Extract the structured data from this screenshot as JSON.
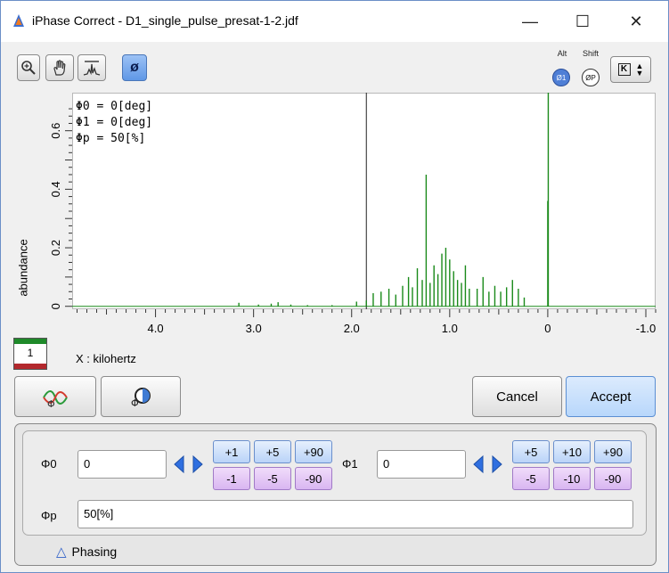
{
  "window": {
    "title": "iPhase Correct - D1_single_pulse_presat-1-2.jdf",
    "minimize_glyph": "—",
    "maximize_glyph": "☐",
    "close_glyph": "✕"
  },
  "toolbar": {
    "tools": [
      {
        "name": "zoom-icon"
      },
      {
        "name": "pan-hand-icon"
      },
      {
        "name": "peak-icon"
      },
      {
        "name": "phase-icon",
        "label": "ø",
        "active": true
      }
    ],
    "modifiers": [
      {
        "key": "Alt",
        "label": "Ø1"
      },
      {
        "key": "Shift",
        "label": "ØP"
      }
    ],
    "k_button_label": "K"
  },
  "plot": {
    "readout": [
      "Φ0 = 0[deg]",
      "Φ1 = 0[deg]",
      "Φp = 50[%]"
    ],
    "y_axis_label": "abundance",
    "x_axis_label": "X : kilohertz",
    "page_number": "1",
    "colors": {
      "spectrum": "#1a8a1a",
      "pivot_line": "#222222",
      "frame": "#b8b8b8"
    }
  },
  "chart_data": {
    "type": "line",
    "ylabel": "abundance",
    "xlabel": "X : kilohertz",
    "xlim": [
      4.85,
      -1.1
    ],
    "ylim": [
      -0.01,
      0.73
    ],
    "x_reversed": true,
    "x_ticks": [
      "4.0",
      "3.0",
      "2.0",
      "1.0",
      "0",
      "-1.0"
    ],
    "x_tick_values": [
      4.0,
      3.0,
      2.0,
      1.0,
      0.0,
      -1.0
    ],
    "y_ticks": [
      "0",
      "0.2",
      "0.4",
      "0.6"
    ],
    "y_tick_values": [
      0.0,
      0.2,
      0.4,
      0.6
    ],
    "pivot_x": 1.85,
    "series": [
      {
        "peaks": [
          [
            3.15,
            0.012
          ],
          [
            2.95,
            0.006
          ],
          [
            2.82,
            0.009
          ],
          [
            2.75,
            0.014
          ],
          [
            2.62,
            0.006
          ],
          [
            2.45,
            0.004
          ],
          [
            2.2,
            0.004
          ],
          [
            1.95,
            0.016
          ],
          [
            1.85,
            0.02
          ],
          [
            1.78,
            0.045
          ],
          [
            1.7,
            0.05
          ],
          [
            1.62,
            0.06
          ],
          [
            1.55,
            0.04
          ],
          [
            1.48,
            0.07
          ],
          [
            1.42,
            0.1
          ],
          [
            1.38,
            0.065
          ],
          [
            1.33,
            0.13
          ],
          [
            1.28,
            0.09
          ],
          [
            1.24,
            0.45
          ],
          [
            1.2,
            0.08
          ],
          [
            1.16,
            0.14
          ],
          [
            1.12,
            0.11
          ],
          [
            1.08,
            0.18
          ],
          [
            1.04,
            0.2
          ],
          [
            1.0,
            0.16
          ],
          [
            0.96,
            0.12
          ],
          [
            0.92,
            0.09
          ],
          [
            0.88,
            0.08
          ],
          [
            0.84,
            0.14
          ],
          [
            0.8,
            0.06
          ],
          [
            0.72,
            0.06
          ],
          [
            0.66,
            0.1
          ],
          [
            0.6,
            0.05
          ],
          [
            0.54,
            0.07
          ],
          [
            0.48,
            0.05
          ],
          [
            0.42,
            0.065
          ],
          [
            0.36,
            0.09
          ],
          [
            0.3,
            0.06
          ],
          [
            0.24,
            0.03
          ],
          [
            0.0,
            0.36
          ],
          [
            -0.005,
            0.73
          ]
        ]
      }
    ]
  },
  "actions": {
    "cancel": "Cancel",
    "accept": "Accept"
  },
  "phasing": {
    "phi0_label": "Φ0",
    "phi0_value": "0",
    "phi1_label": "Φ1",
    "phi1_value": "0",
    "phip_label": "Φp",
    "phip_value": "50[%]",
    "phi0_steps_plus": [
      "+1",
      "+5",
      "+90"
    ],
    "phi0_steps_minus": [
      "-1",
      "-5",
      "-90"
    ],
    "phi1_steps_plus": [
      "+5",
      "+10",
      "+90"
    ],
    "phi1_steps_minus": [
      "-5",
      "-10",
      "-90"
    ],
    "panel_label": "Phasing",
    "panel_toggle_glyph": "△"
  }
}
